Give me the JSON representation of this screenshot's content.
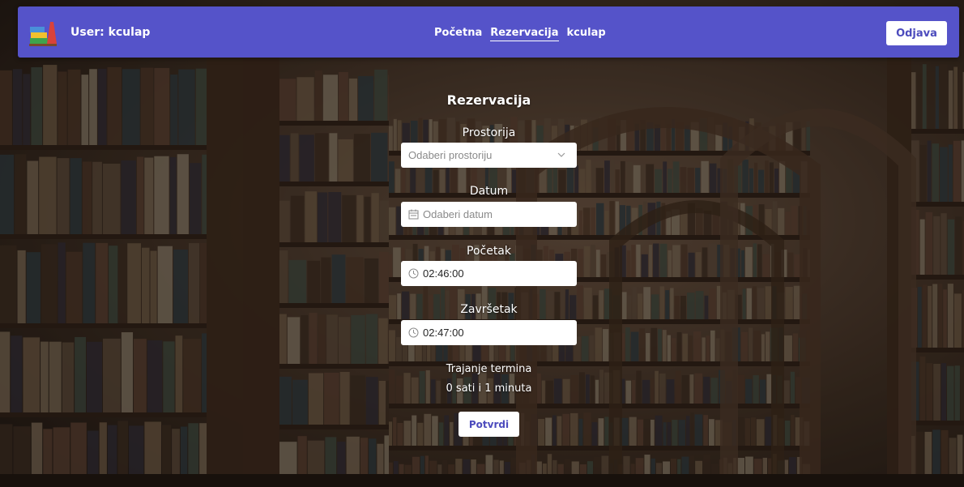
{
  "navbar": {
    "user_label": "User: kculap",
    "links": [
      "Početna",
      "Rezervacija",
      "kculap"
    ],
    "active_link": "Rezervacija",
    "logout_label": "Odjava",
    "color": "#5553c9"
  },
  "form": {
    "title": "Rezervacija",
    "room": {
      "label": "Prostorija",
      "placeholder": "Odaberi prostoriju",
      "icon": "chevron-down-icon"
    },
    "date": {
      "label": "Datum",
      "placeholder": "Odaberi datum",
      "icon": "calendar-icon"
    },
    "start": {
      "label": "Početak",
      "value": "02:46:00",
      "icon": "clock-icon"
    },
    "end": {
      "label": "Završetak",
      "value": "02:47:00",
      "icon": "clock-icon"
    },
    "duration_label": "Trajanje termina",
    "duration_value": "0 sati i 1 minuta",
    "submit_label": "Potvrdi"
  },
  "colors": {
    "accent": "#5553c9",
    "button_text": "#4c4bbd"
  }
}
